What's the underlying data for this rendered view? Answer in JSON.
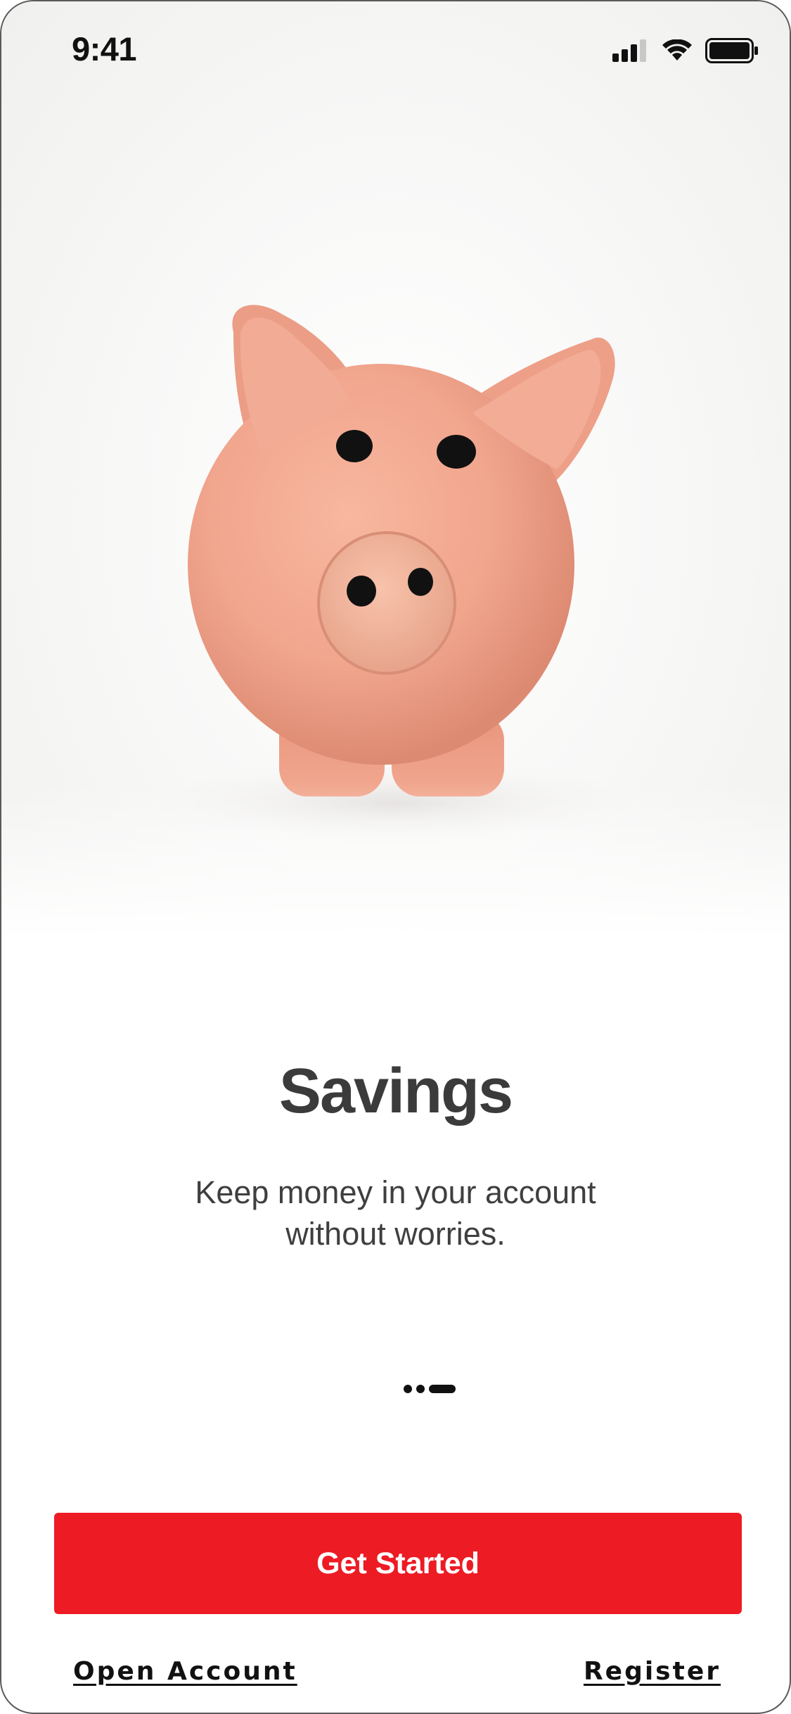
{
  "status_bar": {
    "time": "9:41",
    "icons": [
      "cellular-signal-icon",
      "wifi-icon",
      "battery-icon"
    ]
  },
  "hero": {
    "image": "piggy-bank-photo"
  },
  "onboarding": {
    "title": "Savings",
    "subtitle": "Keep money in your account without worries.",
    "pages": 3,
    "active_page": 3
  },
  "actions": {
    "primary_label": "Get Started",
    "open_account_label": "Open Account",
    "register_label": "Register"
  },
  "colors": {
    "accent": "#ED1B24",
    "text": "#3B3B3B",
    "pig": "#F2A58E"
  }
}
